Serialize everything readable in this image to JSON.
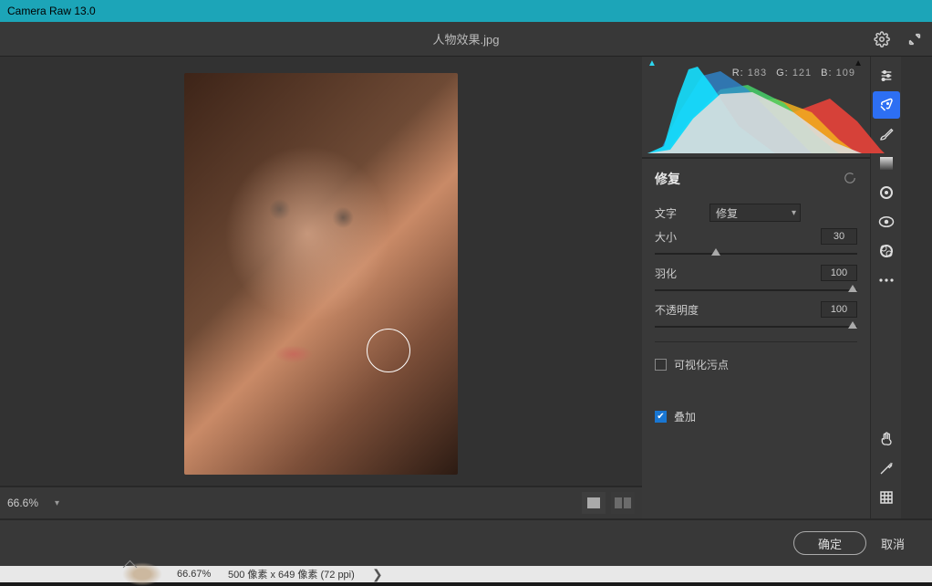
{
  "window": {
    "title": "Camera Raw 13.0"
  },
  "header": {
    "filename": "人物效果.jpg"
  },
  "histogram": {
    "r_label": "R:",
    "r": "183",
    "g_label": "G:",
    "g": "121",
    "b_label": "B:",
    "b": "109"
  },
  "panel": {
    "title": "修复",
    "type_label": "文字",
    "type_value": "修复",
    "sliders": {
      "size": {
        "label": "大小",
        "value": "30",
        "pos": 30
      },
      "feather": {
        "label": "羽化",
        "value": "100",
        "pos": 100
      },
      "opacity": {
        "label": "不透明度",
        "value": "100",
        "pos": 100
      }
    },
    "visualize": {
      "label": "可视化污点",
      "checked": false
    },
    "overlay": {
      "label": "叠加",
      "checked": true
    }
  },
  "zoom": {
    "level": "66.6%"
  },
  "footer": {
    "ok": "确定",
    "cancel": "取消"
  },
  "statusbar": {
    "zoom": "66.67%",
    "dims": "500 像素 x 649 像素 (72 ppi)"
  },
  "tools": [
    {
      "name": "edit-icon",
      "glyph": "sliders",
      "active": false
    },
    {
      "name": "spot-heal-icon",
      "glyph": "healing",
      "active": true
    },
    {
      "name": "brush-icon",
      "glyph": "brush",
      "active": false
    },
    {
      "name": "graduated-icon",
      "glyph": "gradient",
      "active": false
    },
    {
      "name": "radial-icon",
      "glyph": "radial",
      "active": false
    },
    {
      "name": "redeye-icon",
      "glyph": "redeye",
      "active": false
    },
    {
      "name": "snapshot-icon",
      "glyph": "snapshot",
      "active": false
    },
    {
      "name": "preset-more-icon",
      "glyph": "dots",
      "active": false
    }
  ],
  "bottom_tools": [
    {
      "name": "hand-icon",
      "glyph": "hand"
    },
    {
      "name": "magic-icon",
      "glyph": "wand"
    },
    {
      "name": "grid-icon",
      "glyph": "grid"
    }
  ]
}
